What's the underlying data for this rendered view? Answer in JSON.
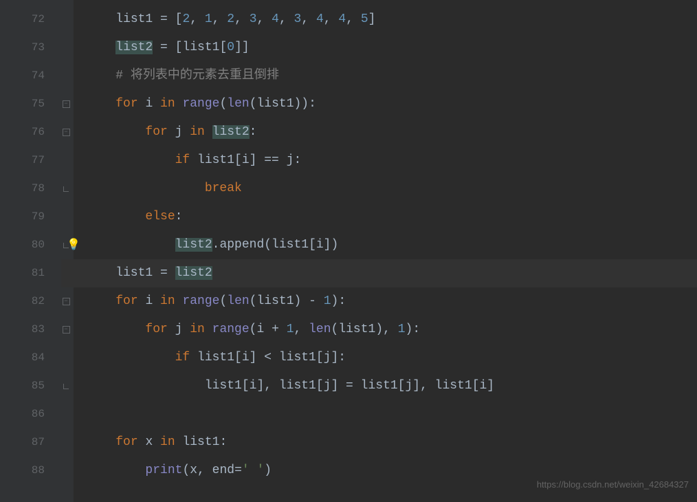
{
  "lines": [
    {
      "num": "72",
      "fold": "",
      "tokens": [
        {
          "t": "    ",
          "c": "var"
        },
        {
          "t": "list1 ",
          "c": "var"
        },
        {
          "t": "= [",
          "c": "op"
        },
        {
          "t": "2",
          "c": "num"
        },
        {
          "t": ", ",
          "c": "op"
        },
        {
          "t": "1",
          "c": "num"
        },
        {
          "t": ", ",
          "c": "op"
        },
        {
          "t": "2",
          "c": "num"
        },
        {
          "t": ", ",
          "c": "op"
        },
        {
          "t": "3",
          "c": "num"
        },
        {
          "t": ", ",
          "c": "op"
        },
        {
          "t": "4",
          "c": "num"
        },
        {
          "t": ", ",
          "c": "op"
        },
        {
          "t": "3",
          "c": "num"
        },
        {
          "t": ", ",
          "c": "op"
        },
        {
          "t": "4",
          "c": "num"
        },
        {
          "t": ", ",
          "c": "op"
        },
        {
          "t": "4",
          "c": "num"
        },
        {
          "t": ", ",
          "c": "op"
        },
        {
          "t": "5",
          "c": "num"
        },
        {
          "t": "]",
          "c": "op"
        }
      ]
    },
    {
      "num": "73",
      "fold": "",
      "tokens": [
        {
          "t": "    ",
          "c": "var"
        },
        {
          "t": "list2",
          "c": "var",
          "hl": true
        },
        {
          "t": " = [list1[",
          "c": "var"
        },
        {
          "t": "0",
          "c": "num"
        },
        {
          "t": "]]",
          "c": "op"
        }
      ]
    },
    {
      "num": "74",
      "fold": "",
      "tokens": [
        {
          "t": "    ",
          "c": "var"
        },
        {
          "t": "# 将列表中的元素去重且倒排",
          "c": "cmt"
        }
      ]
    },
    {
      "num": "75",
      "fold": "minus",
      "tokens": [
        {
          "t": "    ",
          "c": "var"
        },
        {
          "t": "for ",
          "c": "kw"
        },
        {
          "t": "i ",
          "c": "var"
        },
        {
          "t": "in ",
          "c": "kw"
        },
        {
          "t": "range",
          "c": "builtin"
        },
        {
          "t": "(",
          "c": "op"
        },
        {
          "t": "len",
          "c": "builtin"
        },
        {
          "t": "(list1)):",
          "c": "var"
        }
      ]
    },
    {
      "num": "76",
      "fold": "minus",
      "tokens": [
        {
          "t": "        ",
          "c": "var"
        },
        {
          "t": "for ",
          "c": "kw"
        },
        {
          "t": "j ",
          "c": "var"
        },
        {
          "t": "in ",
          "c": "kw"
        },
        {
          "t": "list2",
          "c": "var",
          "hl": true
        },
        {
          "t": ":",
          "c": "op"
        }
      ]
    },
    {
      "num": "77",
      "fold": "",
      "tokens": [
        {
          "t": "            ",
          "c": "var"
        },
        {
          "t": "if ",
          "c": "kw"
        },
        {
          "t": "list1[i] == j:",
          "c": "var"
        }
      ]
    },
    {
      "num": "78",
      "fold": "end",
      "tokens": [
        {
          "t": "                ",
          "c": "var"
        },
        {
          "t": "break",
          "c": "kw"
        }
      ]
    },
    {
      "num": "79",
      "fold": "",
      "tokens": [
        {
          "t": "        ",
          "c": "var"
        },
        {
          "t": "else",
          "c": "kw"
        },
        {
          "t": ":",
          "c": "op"
        }
      ]
    },
    {
      "num": "80",
      "fold": "end",
      "bulb": true,
      "tokens": [
        {
          "t": "            ",
          "c": "var"
        },
        {
          "t": "list2",
          "c": "var",
          "hl": true
        },
        {
          "t": ".append(list1[i])",
          "c": "var"
        }
      ]
    },
    {
      "num": "81",
      "fold": "",
      "highlight": true,
      "tokens": [
        {
          "t": "    list1 = ",
          "c": "var"
        },
        {
          "t": "list2",
          "c": "var",
          "hl": true
        }
      ]
    },
    {
      "num": "82",
      "fold": "minus",
      "tokens": [
        {
          "t": "    ",
          "c": "var"
        },
        {
          "t": "for ",
          "c": "kw"
        },
        {
          "t": "i ",
          "c": "var"
        },
        {
          "t": "in ",
          "c": "kw"
        },
        {
          "t": "range",
          "c": "builtin"
        },
        {
          "t": "(",
          "c": "op"
        },
        {
          "t": "len",
          "c": "builtin"
        },
        {
          "t": "(list1) - ",
          "c": "var"
        },
        {
          "t": "1",
          "c": "num"
        },
        {
          "t": "):",
          "c": "var"
        }
      ]
    },
    {
      "num": "83",
      "fold": "minus",
      "tokens": [
        {
          "t": "        ",
          "c": "var"
        },
        {
          "t": "for ",
          "c": "kw"
        },
        {
          "t": "j ",
          "c": "var"
        },
        {
          "t": "in ",
          "c": "kw"
        },
        {
          "t": "range",
          "c": "builtin"
        },
        {
          "t": "(i + ",
          "c": "var"
        },
        {
          "t": "1",
          "c": "num"
        },
        {
          "t": ", ",
          "c": "op"
        },
        {
          "t": "len",
          "c": "builtin"
        },
        {
          "t": "(list1), ",
          "c": "var"
        },
        {
          "t": "1",
          "c": "num"
        },
        {
          "t": "):",
          "c": "var"
        }
      ]
    },
    {
      "num": "84",
      "fold": "",
      "tokens": [
        {
          "t": "            ",
          "c": "var"
        },
        {
          "t": "if ",
          "c": "kw"
        },
        {
          "t": "list1[i] < list1[j]:",
          "c": "var"
        }
      ]
    },
    {
      "num": "85",
      "fold": "end",
      "tokens": [
        {
          "t": "                list1[i], list1[j] = list1[j], list1[i]",
          "c": "var"
        }
      ]
    },
    {
      "num": "86",
      "fold": "",
      "tokens": []
    },
    {
      "num": "87",
      "fold": "",
      "tokens": [
        {
          "t": "    ",
          "c": "var"
        },
        {
          "t": "for ",
          "c": "kw"
        },
        {
          "t": "x ",
          "c": "var"
        },
        {
          "t": "in ",
          "c": "kw"
        },
        {
          "t": "list1:",
          "c": "var"
        }
      ]
    },
    {
      "num": "88",
      "fold": "",
      "tokens": [
        {
          "t": "        ",
          "c": "var"
        },
        {
          "t": "print",
          "c": "builtin"
        },
        {
          "t": "(x, ",
          "c": "var"
        },
        {
          "t": "end",
          "c": "var"
        },
        {
          "t": "=",
          "c": "op"
        },
        {
          "t": "' '",
          "c": "str"
        },
        {
          "t": ")",
          "c": "op"
        }
      ]
    }
  ],
  "watermark": "https://blog.csdn.net/weixin_42684327"
}
